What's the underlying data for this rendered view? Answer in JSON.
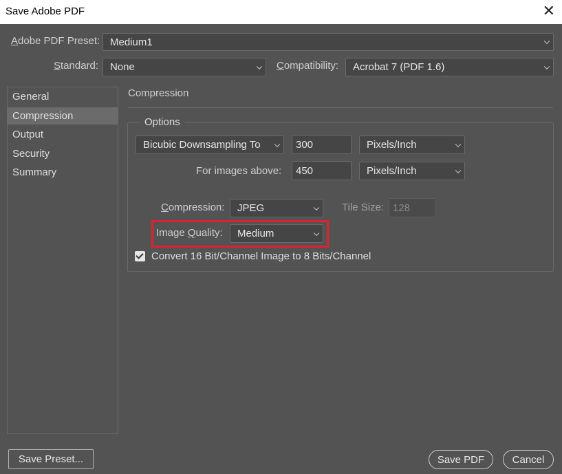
{
  "window": {
    "title": "Save Adobe PDF",
    "close_glyph": "✕"
  },
  "header": {
    "preset_label": "Adobe PDF Preset:",
    "preset_value": "Medium1",
    "standard_label": "Standard:",
    "standard_value": "None",
    "compatibility_label": "Compatibility:",
    "compatibility_value": "Acrobat 7 (PDF 1.6)"
  },
  "sidebar": {
    "items": [
      {
        "label": "General"
      },
      {
        "label": "Compression",
        "active": true
      },
      {
        "label": "Output"
      },
      {
        "label": "Security"
      },
      {
        "label": "Summary"
      }
    ]
  },
  "main": {
    "section_title": "Compression",
    "options": {
      "group_title": "Options",
      "downsampling_method": "Bicubic Downsampling To",
      "downsample_ppi": "300",
      "downsample_unit": "Pixels/Inch",
      "images_above_label": "For images above:",
      "images_above_ppi": "450",
      "images_above_unit": "Pixels/Inch",
      "compression_label": "Compression:",
      "compression_value": "JPEG",
      "tile_size_label": "Tile Size:",
      "tile_size_value": "128",
      "image_quality_label": "Image Quality:",
      "image_quality_value": "Medium",
      "convert_checkbox_label": "Convert 16 Bit/Channel Image to 8 Bits/Channel",
      "convert_checked": true
    }
  },
  "footer": {
    "save_preset_label": "Save Preset...",
    "save_pdf_label": "Save PDF",
    "cancel_label": "Cancel"
  },
  "colors": {
    "dialog_bg": "#535353",
    "highlight": "#e0212b"
  }
}
